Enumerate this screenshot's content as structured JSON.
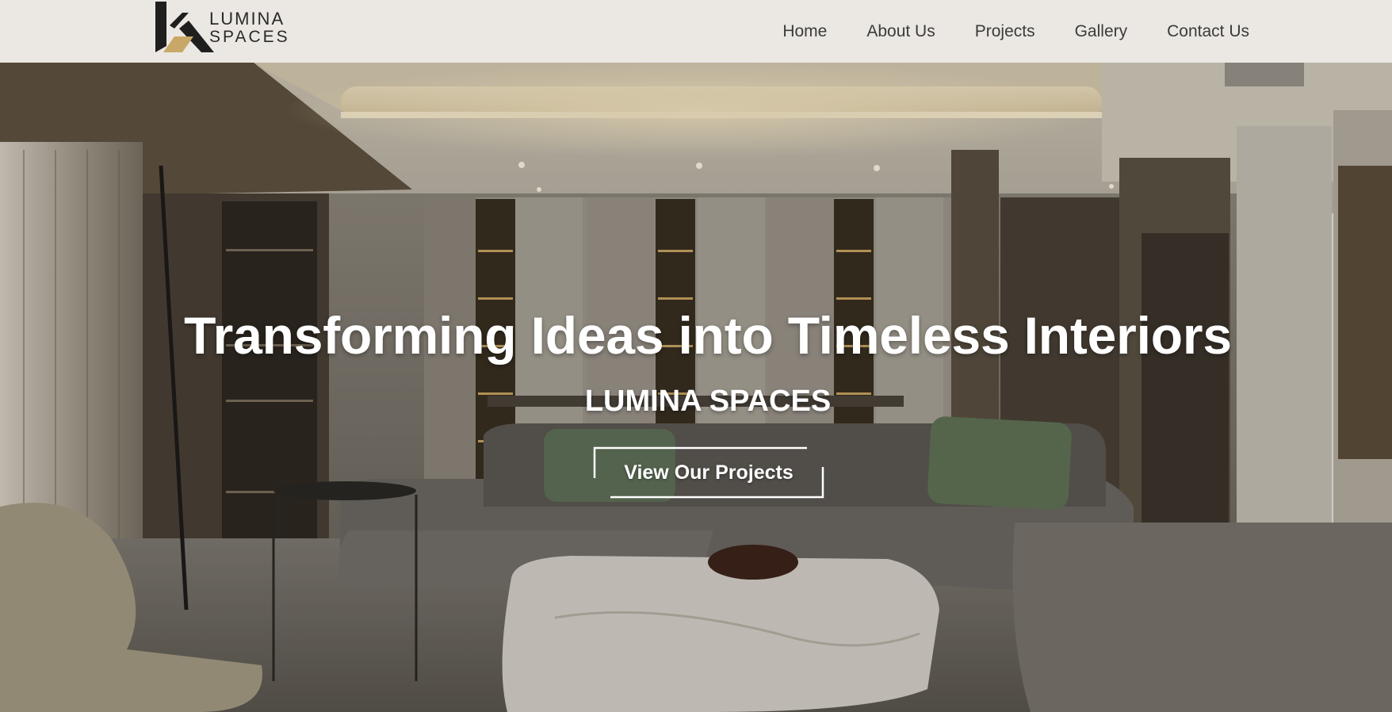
{
  "brand": {
    "name_line1": "LUMINA",
    "name_line2": "SPACES",
    "accent_color": "#c9a867",
    "mark_color": "#1f1f1f"
  },
  "nav": {
    "items": [
      {
        "label": "Home"
      },
      {
        "label": "About Us"
      },
      {
        "label": "Projects"
      },
      {
        "label": "Gallery"
      },
      {
        "label": "Contact Us"
      }
    ]
  },
  "hero": {
    "title": "Transforming Ideas into Timeless Interiors",
    "subtitle": "LUMINA SPACES",
    "cta_label": "View Our Projects",
    "image_icon": "living-room-photo"
  },
  "colors": {
    "header_bg": "#ebe8e3",
    "nav_text": "#3b3b3b",
    "hero_text": "#ffffff"
  }
}
